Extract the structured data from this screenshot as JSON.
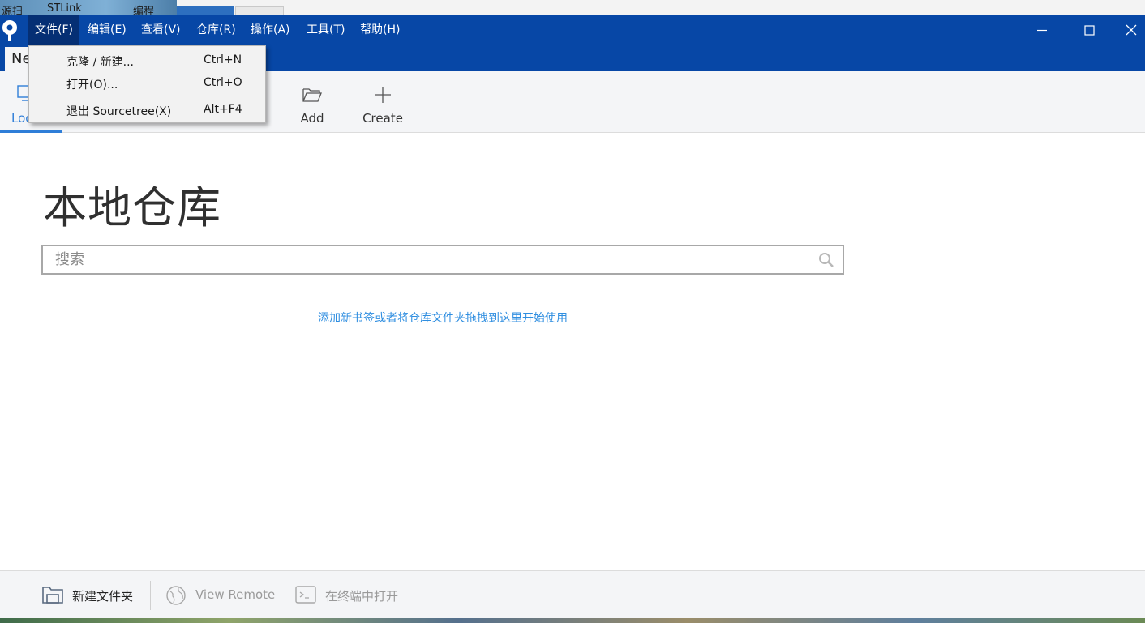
{
  "desktop": {
    "top_texts": [
      "源扫",
      "STLink",
      "编程"
    ]
  },
  "titlebar": {
    "menus": [
      "文件(F)",
      "编辑(E)",
      "查看(V)",
      "仓库(R)",
      "操作(A)",
      "工具(T)",
      "帮助(H)"
    ],
    "active_menu_index": 0
  },
  "tab": {
    "label": "Ne"
  },
  "toolbar": {
    "local_label": "Loc",
    "add_label": "Add",
    "create_label": "Create"
  },
  "main": {
    "title": "本地仓库",
    "search_placeholder": "搜索",
    "search_value": "",
    "hint": "添加新书签或者将仓库文件夹拖拽到这里开始使用"
  },
  "bottombar": {
    "new_folder_label": "新建文件夹",
    "view_remote_label": "View Remote",
    "open_terminal_label": "在终端中打开"
  },
  "file_menu": {
    "items": [
      {
        "label": "克隆 / 新建...",
        "shortcut": "Ctrl+N"
      },
      {
        "label": "打开(O)...",
        "shortcut": "Ctrl+O"
      },
      {
        "label": "退出 Sourcetree(X)",
        "shortcut": "Alt+F4"
      }
    ]
  },
  "colors": {
    "titlebar": "#0747a6",
    "accent": "#2f7ed8",
    "link": "#2f8ee0"
  },
  "icons": {
    "app": "sourcetree-logo-icon",
    "search": "search-icon",
    "add": "folder-open-icon",
    "create": "plus-icon",
    "new_folder": "folder-icon",
    "view_remote": "globe-icon",
    "terminal": "terminal-icon"
  }
}
